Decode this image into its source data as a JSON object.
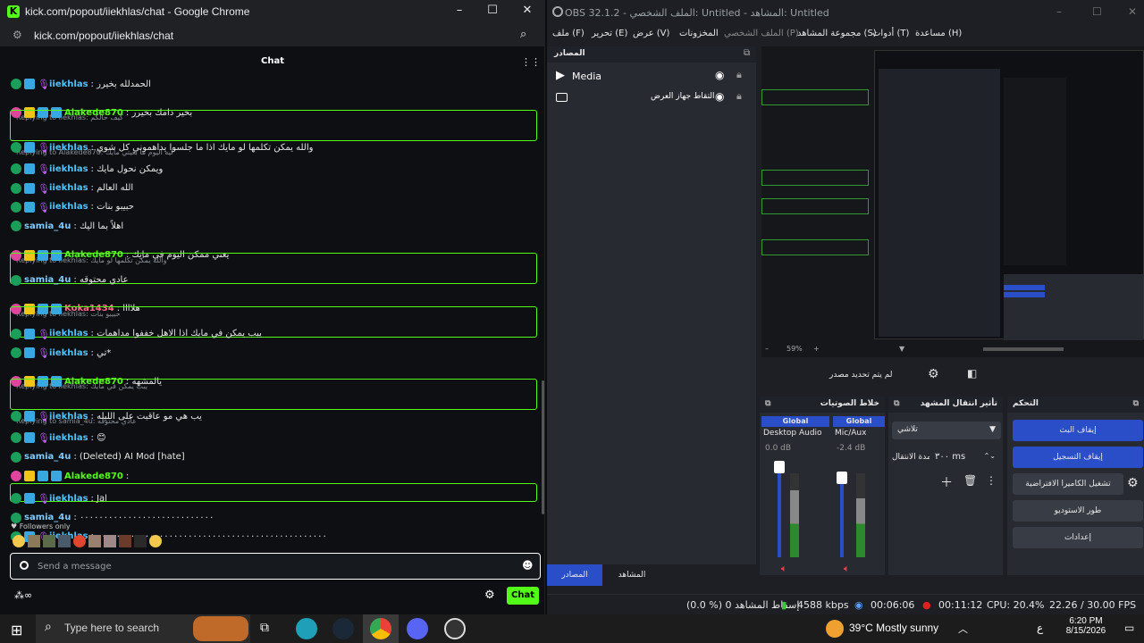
{
  "chrome": {
    "title": "kick.com/popout/iiekhlas/chat - Google Chrome",
    "url": "kick.com/popout/iiekhlas/chat",
    "chat_header": "Chat",
    "followers_only": "Followers only",
    "input_placeholder": "Send a message",
    "chat_button": "Chat",
    "messages": [
      {
        "user": "iiekhlas",
        "text": ": الحمدلله بخيرر",
        "cls": "u-iie"
      },
      {
        "reply": "Replying to iiekhlas: كيف حالكم",
        "user": "Alakede870",
        "text": ": بخير دامك بخيرر",
        "cls": "u-ala"
      },
      {
        "reply": "Replying to Alakede870: ليه اليوم ما بغيتي مايك",
        "user": "iiekhlas",
        "text": ": والله يمكن تكلمها لو مايك اذا ما جلسوا يداهموني كل شوي",
        "cls": "u-iie"
      },
      {
        "user": "iiekhlas",
        "text": ": ويمكن نحول مايك",
        "cls": "u-iie"
      },
      {
        "user": "iiekhlas",
        "text": ": الله العالم",
        "cls": "u-iie"
      },
      {
        "user": "iiekhlas",
        "text": ": حبيبو بنات",
        "cls": "u-iie"
      },
      {
        "user": "samia_4u",
        "text": ": اهلاً بما اليك",
        "cls": "u-sam"
      },
      {
        "reply": "Replying to iiekhlas: والله يمكن تكلمها لو مايك",
        "user": "Alakede870",
        "text": ": يعني ممكن اليوم في مايك",
        "cls": "u-ala"
      },
      {
        "user": "samia_4u",
        "text": ": عادي محتوقه",
        "cls": "u-sam"
      },
      {
        "reply": "Replying to iiekhlas: حبيبو بنات",
        "user": "Koka1434",
        "text": ": هلاااا",
        "cls": "u-kok"
      },
      {
        "user": "iiekhlas",
        "text": ": يبب يمكن في مايك اذا الاهل خففوا مداهمات",
        "cls": "u-iie"
      },
      {
        "user": "iiekhlas",
        "text": ": تي*",
        "cls": "u-iie"
      },
      {
        "reply": "Replying to iiekhlas: يبب يمكن في مايك",
        "user": "Alakede870",
        "text": ": يالمشهه",
        "cls": "u-ala"
      },
      {
        "reply": "Replying to samia_4u: عادي محتوقه",
        "user": "iiekhlas",
        "text": ": يب هي مو عاقبت على الليله",
        "cls": "u-iie"
      },
      {
        "user": "iiekhlas",
        "text": ": 😊",
        "cls": "u-iie"
      },
      {
        "user": "samia_4u",
        "text": ": (Deleted) AI Mod [hate]",
        "cls": "u-sam"
      },
      {
        "user": "Alakede870",
        "text": ":",
        "cls": "u-ala"
      },
      {
        "user": "iiekhlas",
        "text": ": Jal",
        "cls": "u-iie"
      },
      {
        "user": "samia_4u",
        "text": ": ٠٠٠٠٠٠٠٠٠٠٠٠٠٠٠٠٠٠٠٠٠٠٠٠٠٠٠٠",
        "cls": "u-sam"
      },
      {
        "user": "iiekhlas",
        "text": ": ٠٠٠٠٠٠٠٠٠٠٠٠٠٠٠٠٠٠٠٠٠٠٠٠٠٠٠٠٠٠٠٠٠٠٠٠٠٠٠٠٠٠٠٠٠٠٠٠",
        "cls": "u-iie"
      }
    ]
  },
  "obs": {
    "title": "OBS 32.1.2 - الملف الشخصي: Untitled - المشاهد: Untitled",
    "menu": [
      "ملف (F)",
      "تحرير (E)",
      "عرض (V)",
      "المخزونات",
      "الملف الشخصي (P)",
      "مجموعة المشاهد (S)",
      "أدوات (T)",
      "مساعدة (H)"
    ],
    "sources_header": "المصادر",
    "sources": [
      "Media",
      "التقاط جهاز العرض"
    ],
    "no_source": "لم يتم تحديد مصدر",
    "zoom": "59%",
    "mixer_header": "خلاط الصوتيات",
    "transition_header": "تأثير انتقال المشهد",
    "controls_header": "التحكم",
    "mixer": {
      "ch1": {
        "label": "Global",
        "name": "Desktop Audio",
        "db": "0.0 dB"
      },
      "ch2": {
        "label": "Global",
        "name": "Mic/Aux",
        "db": "-2.4 dB"
      }
    },
    "transition": {
      "type": "تلاشي",
      "duration_label": "مدة الانتقال",
      "duration": "٣٠٠ ms"
    },
    "controls": [
      "إيقاف البث",
      "إيقاف التسجيل",
      "تشغيل الكاميرا الافتراضية",
      "طور الاستوديو",
      "إعدادات"
    ],
    "tabs": [
      "المصادر",
      "المشاهد"
    ],
    "status": {
      "dropped": "(0.0 %) 0 إسقاط المشاهد",
      "bitrate": "4588 kbps",
      "stream_time": "00:06:06",
      "rec_time": "00:11:12",
      "cpu": "CPU: 20.4%",
      "fps": "22.26 / 30.00 FPS"
    }
  },
  "taskbar": {
    "search": "Type here to search",
    "weather": "39°C  Mostly sunny",
    "time": "6:20 PM",
    "date": "8/15/2026",
    "lang": "ع"
  }
}
